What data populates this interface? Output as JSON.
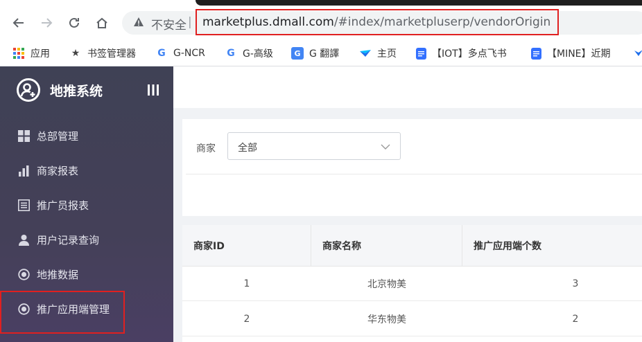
{
  "browser": {
    "insecure_label": "不安全",
    "url_host": "marketplus.dmall.com",
    "url_path": "/#index/marketpluserp/vendorOrigin"
  },
  "bookmarks": [
    {
      "icon": "apps-grid-icon",
      "label": "应用"
    },
    {
      "icon": "star-icon",
      "label": "书签管理器"
    },
    {
      "icon": "google-icon",
      "label": "G-NCR"
    },
    {
      "icon": "google-icon",
      "label": "G-高级"
    },
    {
      "icon": "translate-icon",
      "label": "G 翻譯"
    },
    {
      "icon": "bird-icon",
      "label": "主页"
    },
    {
      "icon": "doc-icon",
      "label": "【IOT】多点飞书"
    },
    {
      "icon": "doc-icon",
      "label": "【MINE】近期"
    }
  ],
  "sidebar": {
    "title": "地推系统",
    "collapse_icon": "menu-collapse-icon",
    "items": [
      {
        "icon": "grid-icon",
        "label": "总部管理"
      },
      {
        "icon": "bar-chart-icon",
        "label": "商家报表"
      },
      {
        "icon": "list-icon",
        "label": "推广员报表"
      },
      {
        "icon": "user-icon",
        "label": "用户记录查询"
      },
      {
        "icon": "radio-icon",
        "label": "地推数据"
      },
      {
        "icon": "radio-icon",
        "label": "推广应用端管理"
      }
    ]
  },
  "filter": {
    "label": "商家",
    "selected": "全部"
  },
  "table": {
    "headers": [
      "商家ID",
      "商家名称",
      "推广应用端个数"
    ],
    "rows": [
      [
        "1",
        "北京物美",
        "3"
      ],
      [
        "2",
        "华东物美",
        "2"
      ]
    ]
  },
  "colors": {
    "sidebar_top": "#3f4155",
    "sidebar_bottom": "#4a3f63",
    "highlight_red": "#e02020"
  }
}
